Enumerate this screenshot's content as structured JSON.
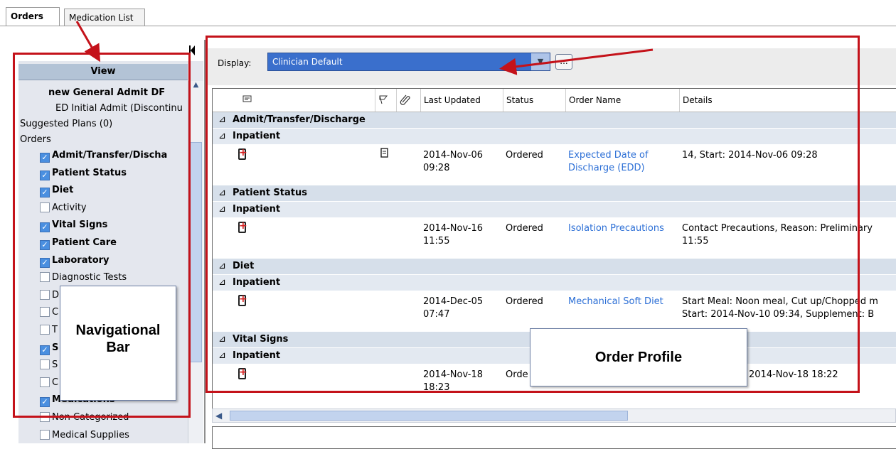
{
  "tabs": [
    {
      "label": "Orders",
      "active": true
    },
    {
      "label": "Medication List",
      "active": false
    }
  ],
  "nav": {
    "header": "View",
    "items": [
      {
        "label": "new  General Admit DF",
        "bold": true,
        "checkbox": "none",
        "indent": 2
      },
      {
        "label": "ED Initial Admit (Discontinu",
        "bold": false,
        "checkbox": "none",
        "indent": 2
      },
      {
        "label": "Suggested Plans (0)",
        "bold": false,
        "checkbox": "none",
        "indent": 0
      },
      {
        "label": "Orders",
        "bold": false,
        "checkbox": "none",
        "indent": 0
      },
      {
        "label": "Admit/Transfer/Discha",
        "bold": true,
        "checkbox": "on",
        "indent": 1
      },
      {
        "label": "Patient Status",
        "bold": true,
        "checkbox": "on",
        "indent": 1
      },
      {
        "label": "Diet",
        "bold": true,
        "checkbox": "on",
        "indent": 1
      },
      {
        "label": "Activity",
        "bold": false,
        "checkbox": "off",
        "indent": 1
      },
      {
        "label": "Vital Signs",
        "bold": true,
        "checkbox": "on",
        "indent": 1
      },
      {
        "label": "Patient Care",
        "bold": true,
        "checkbox": "on",
        "indent": 1
      },
      {
        "label": "Laboratory",
        "bold": true,
        "checkbox": "on",
        "indent": 1
      },
      {
        "label": "Diagnostic Tests",
        "bold": false,
        "checkbox": "off",
        "indent": 1
      },
      {
        "label": "D",
        "bold": false,
        "checkbox": "off",
        "indent": 1
      },
      {
        "label": "C",
        "bold": false,
        "checkbox": "off",
        "indent": 1
      },
      {
        "label": "T",
        "bold": false,
        "checkbox": "off",
        "indent": 1
      },
      {
        "label": "S",
        "bold": true,
        "checkbox": "on",
        "indent": 1
      },
      {
        "label": "S",
        "bold": false,
        "checkbox": "off",
        "indent": 1
      },
      {
        "label": "C",
        "bold": false,
        "checkbox": "off",
        "indent": 1
      },
      {
        "label": "Medications",
        "bold": true,
        "checkbox": "on",
        "indent": 1
      },
      {
        "label": "Non Categorized",
        "bold": false,
        "checkbox": "off",
        "indent": 1
      },
      {
        "label": "Medical Supplies",
        "bold": false,
        "checkbox": "off",
        "indent": 1
      }
    ]
  },
  "toolbar": {
    "display_label": "Display:",
    "display_value": "Clinician Default",
    "ellipsis_label": "...",
    "dropdown_arrow": "▼"
  },
  "columns": {
    "icon_col": "",
    "flag_col": "",
    "link_col": "",
    "last_updated": "Last Updated",
    "status": "Status",
    "order_name": "Order Name",
    "details": "Details"
  },
  "groups": [
    {
      "category": "Admit/Transfer/Discharge",
      "subgroup": "Inpatient",
      "row": {
        "date": "2014-Nov-06",
        "time": "09:28",
        "status": "Ordered",
        "name_line1": "Expected Date of",
        "name_line2": "Discharge (EDD)",
        "details_line1": "14, Start: 2014-Nov-06 09:28",
        "details_line2": "",
        "has_doc_icon": true
      }
    },
    {
      "category": "Patient Status",
      "subgroup": "Inpatient",
      "row": {
        "date": "2014-Nov-16",
        "time": "11:55",
        "status": "Ordered",
        "name_line1": "Isolation Precautions",
        "name_line2": "",
        "details_line1": "Contact Precautions, Reason: Preliminary",
        "details_line2": "11:55",
        "has_doc_icon": false
      }
    },
    {
      "category": "Diet",
      "subgroup": "Inpatient",
      "row": {
        "date": "2014-Dec-05",
        "time": "07:47",
        "status": "Ordered",
        "name_line1": "Mechanical Soft Diet",
        "name_line2": "",
        "details_line1": "Start Meal: Noon meal, Cut up/Chopped m",
        "details_line2": "Start: 2014-Nov-10 09:34, Supplement: B",
        "has_doc_icon": false
      }
    },
    {
      "category": "Vital Signs",
      "subgroup": "Inpatient",
      "row": {
        "date": "2014-Nov-18",
        "time": "18:23",
        "status": "Orde",
        "name_line1": "",
        "name_line2": "",
        "details_line1": "2014-Nov-18 18:22",
        "details_line2": "",
        "has_doc_icon": false
      }
    }
  ],
  "annotations": {
    "nav_callout_line1": "Navigational",
    "nav_callout_line2": "Bar",
    "order_callout": "Order Profile"
  },
  "colors": {
    "annotation_red": "#c4121a",
    "link_blue": "#2c6fd6",
    "select_blue": "#3a6fcc",
    "group_bg": "#d6dfea"
  }
}
